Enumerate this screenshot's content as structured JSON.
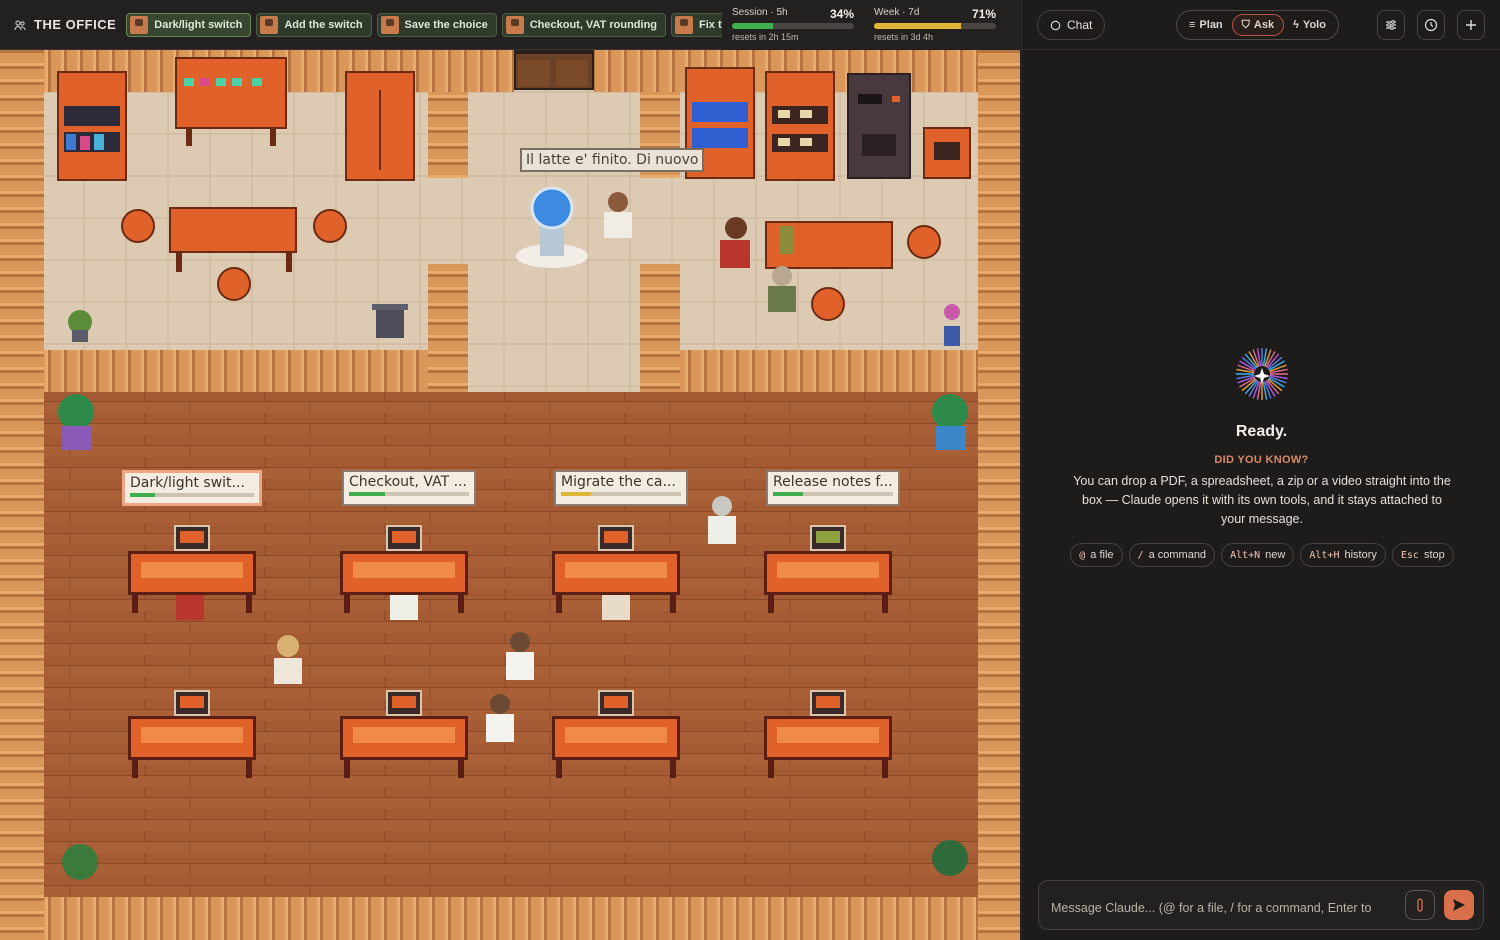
{
  "app": {
    "title": "THE OFFICE"
  },
  "tabs": [
    {
      "label": "Dark/light switch",
      "active": true
    },
    {
      "label": "Add the switch",
      "active": false
    },
    {
      "label": "Save the choice",
      "active": false
    },
    {
      "label": "Checkout, VAT rounding",
      "active": false
    },
    {
      "label": "Fix the",
      "active": false
    }
  ],
  "meters": {
    "session": {
      "label": "Session · 5h",
      "percent_text": "34%",
      "fill": 0.34,
      "reset": "resets in 2h 15m",
      "color": "#3fae4f"
    },
    "week": {
      "label": "Week · 7d",
      "percent_text": "71%",
      "fill": 0.71,
      "reset": "resets in 3d 4h",
      "color": "#e0b63a"
    }
  },
  "office": {
    "speech": "Il latte e' finito. Di nuovo",
    "desks": [
      {
        "label": "Dark/light swit...",
        "progress": 0.2,
        "color": "#3fae4f",
        "highlight": true
      },
      {
        "label": "Checkout, VAT ...",
        "progress": 0.3,
        "color": "#3fae4f",
        "highlight": false
      },
      {
        "label": "Migrate the ca...",
        "progress": 0.25,
        "color": "#e0b63a",
        "highlight": false
      },
      {
        "label": "Release notes f...",
        "progress": 0.25,
        "color": "#3fae4f",
        "highlight": false
      }
    ]
  },
  "sidebar": {
    "chat_label": "Chat",
    "modes": [
      {
        "label": "Plan",
        "icon": "list-icon",
        "active": false
      },
      {
        "label": "Ask",
        "icon": "shield-icon",
        "active": true
      },
      {
        "label": "Yolo",
        "icon": "bolt-icon",
        "active": false
      }
    ],
    "ready_title": "Ready.",
    "tip_heading": "DID YOU KNOW?",
    "tip_text": "You can drop a PDF, a spreadsheet, a zip or a video straight into the box — Claude opens it with its own tools, and it stays attached to your message.",
    "shortcuts": [
      {
        "key": "@",
        "label": "a file"
      },
      {
        "key": "/",
        "label": "a command"
      },
      {
        "key": "Alt+N",
        "label": "new"
      },
      {
        "key": "Alt+H",
        "label": "history"
      },
      {
        "key": "Esc",
        "label": "stop"
      }
    ],
    "input_placeholder": "Message Claude... (@ for a file, / for a command, Enter to"
  },
  "colors": {
    "accent": "#d96f4b",
    "wood": "#a5592f",
    "tile": "#d9c6ad"
  }
}
